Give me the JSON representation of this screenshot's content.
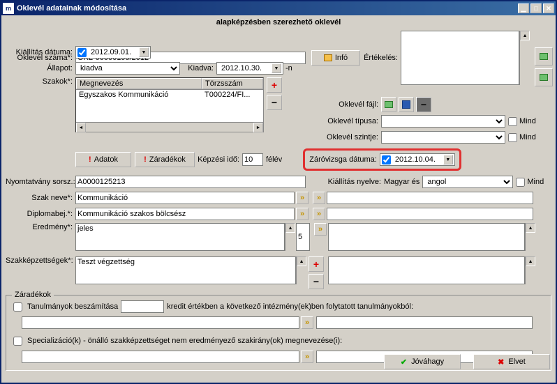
{
  "window": {
    "title": "Oklevél adatainak módosítása"
  },
  "subtitle": "alapképzésben szerezhető oklevél",
  "labels": {
    "oklevel_szama": "Oklevél száma",
    "kiallitas_datuma": "Kiállítás dátuma:",
    "allapot": "Állapot:",
    "kiadva": "Kiadva:",
    "n_suffix": "-n",
    "szakok": "Szakok",
    "info": "Infó",
    "ertekeles": "Értékelés:",
    "oklevel_fajl": "Oklevél fájl:",
    "oklevel_tipusa": "Oklevél típusa:",
    "oklevel_szintje": "Oklevél szintje:",
    "zarovizsga_datuma": "Záróvizsga dátuma:",
    "kiallitas_nyelve": "Kiállítás nyelve:",
    "mind": "Mind",
    "magyar_es": "Magyar és",
    "adatok": "Adatok",
    "zaradekok_btn": "Záradékok",
    "kepzesi_ido": "Képzési idő:",
    "felev": "félév",
    "nyomtatvany_sorsz": "Nyomtatvány sorsz.:",
    "szak_neve": "Szak neve",
    "diplomabej": "Diplomabej.",
    "eredmeny": "Eredmény",
    "szakkepzettsegek": "Szakképzettségek",
    "zaradekok": "Záradékok",
    "tanulmanyok_beszamitasa": "Tanulmányok beszámítása",
    "kredit_ertekben": "kredit értékben a következő intézmény(ek)ben folytatott tanulmányokból:",
    "specializaciok": "Specializáció(k) - önálló szakképzettséget nem eredményező szakirány(ok) megnevezése(i):",
    "jovahagy": "Jóváhagy",
    "elvet": "Elvet"
  },
  "values": {
    "oklevel_szama": "OKL-00000195/2012",
    "kiallitas_datuma": "2012.09.01.",
    "allapot": "kiadva",
    "kiadva_datum": "2012.10.30.",
    "zarovizsga_datuma": "2012.10.04.",
    "kiallitas_nyelve_opt": "angol",
    "kepzesi_ido": "10",
    "nyomtatvany_sorsz": "A0000125213",
    "szak_neve": "Kommunikáció",
    "diplomabej": "Kommunikáció szakos bölcsész",
    "eredmeny": "jeles",
    "eredmeny_szam": "5",
    "szakkepzettsegek": "Teszt végzettség"
  },
  "szakok_table": {
    "headers": {
      "megnevezes": "Megnevezés",
      "torzsszam": "Törzsszám"
    },
    "rows": [
      {
        "megnevezes": "Egyszakos Kommunikáció",
        "torzsszam": "T000224/FI..."
      }
    ]
  }
}
